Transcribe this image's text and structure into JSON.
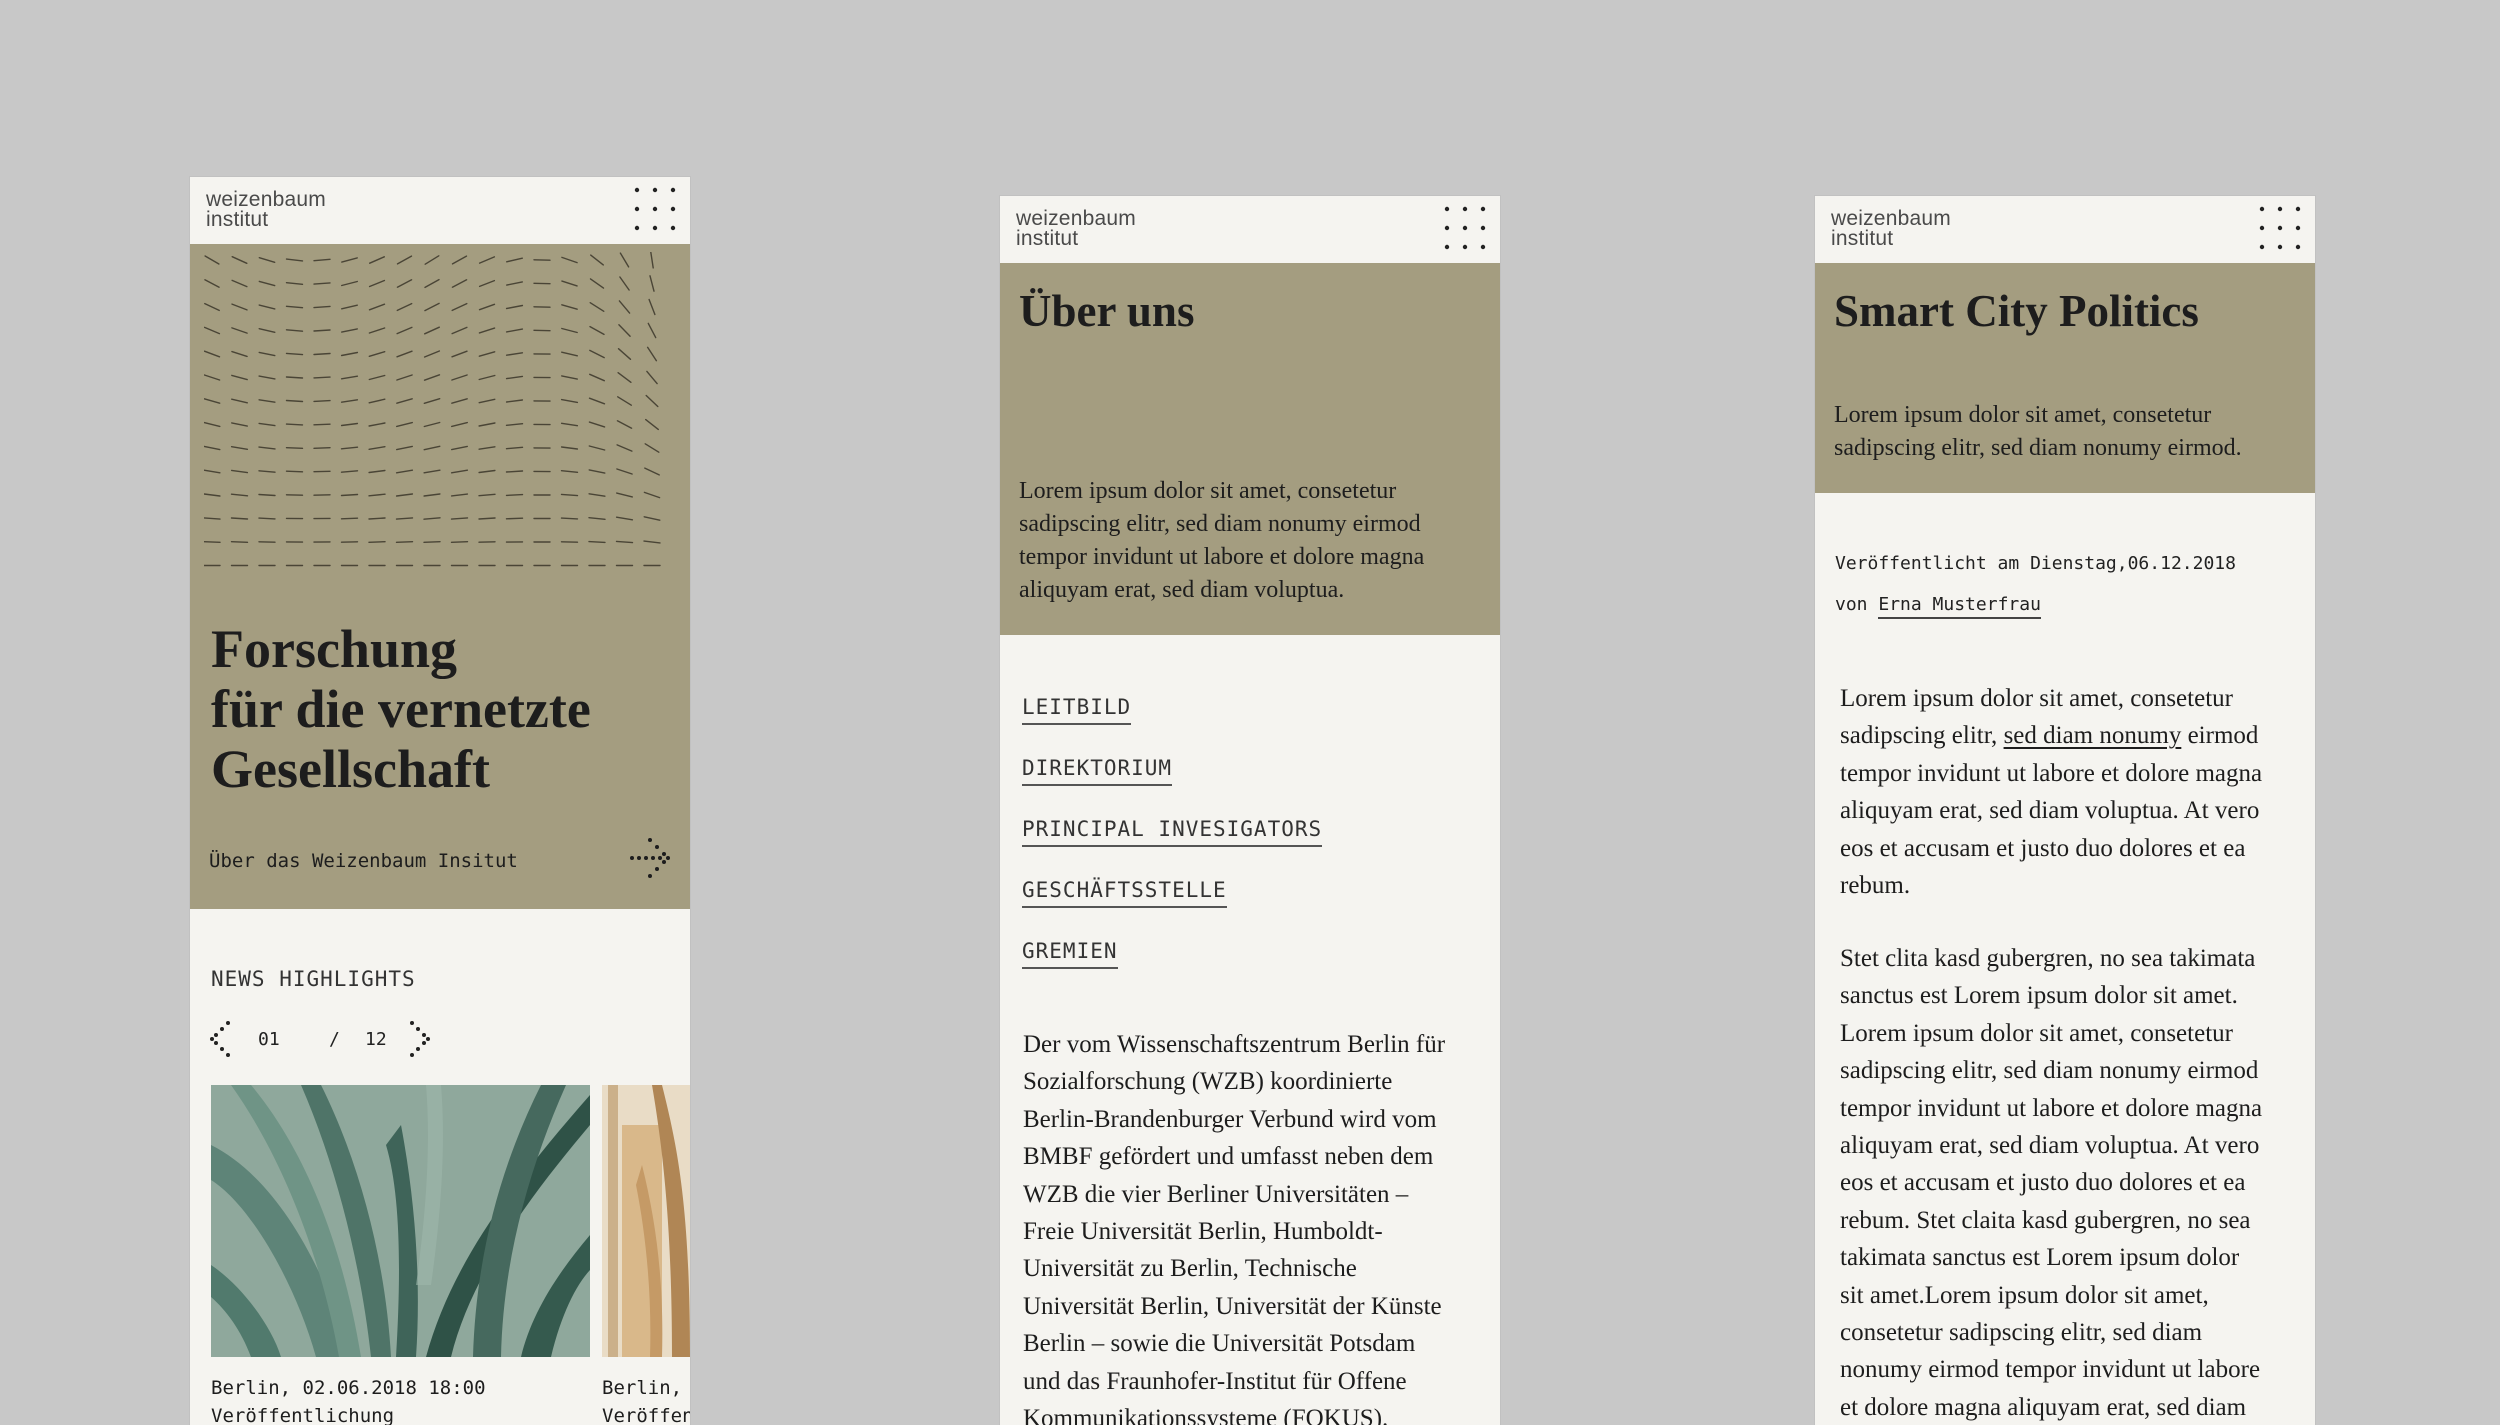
{
  "logo": {
    "line1": "weizenbaum",
    "line2": "institut"
  },
  "colors": {
    "background": "#c8c8c8",
    "page": "#f5f4f0",
    "olive": "#a49d80",
    "text": "#1d1d1d"
  },
  "icons": {
    "menu": "dot-grid-menu-icon",
    "arrow": "dotted-arrow-icon"
  },
  "home": {
    "hero_title": [
      "Forschung",
      "für die vernetzte",
      "Gesellschaft"
    ],
    "hero_link": "Über das Weizenbaum Insitut",
    "news_label": "NEWS HIGHLIGHTS",
    "pager": {
      "current": "01",
      "separator": "/",
      "total": "12"
    },
    "cards": [
      {
        "meta": "Berlin, 02.06.2018 18:00",
        "type": "Veröffentlichung"
      },
      {
        "meta": "Berlin,",
        "type": "Veröffen"
      }
    ]
  },
  "about": {
    "title": "Über uns",
    "intro": [
      "Lorem ipsum dolor sit amet, consetetur",
      "sadipscing elitr, sed diam nonumy eirmod",
      "tempor invidunt ut labore et dolore magna",
      "aliquyam erat, sed diam voluptua."
    ],
    "subnav": [
      "LEITBILD",
      "DIREKTORIUM",
      "PRINCIPAL INVESIGATORS",
      "GESCHÄFTSSTELLE",
      "GREMIEN"
    ],
    "body": [
      "Der vom Wissenschaftszentrum Berlin für",
      "Sozialforschung (WZB) koordinierte",
      "Berlin-Brandenburger Verbund wird vom",
      "BMBF gefördert und umfasst neben dem",
      "WZB die vier Berliner Universitäten –",
      "Freie Universität Berlin, Humboldt-",
      "Universität zu Berlin, Technische",
      "Universität Berlin, Universität der Künste",
      "Berlin – sowie die Universität Potsdam",
      "und das Fraunhofer-Institut für Offene",
      "Kommunikationssysteme (FOKUS)."
    ]
  },
  "article": {
    "title": "Smart City Politics",
    "intro": [
      "Lorem ipsum dolor sit amet, consetetur",
      "sadipscing elitr, sed diam nonumy eirmod."
    ],
    "published": "Veröffentlicht am Dienstag,06.12.2018",
    "by": "von",
    "author": "Erna Musterfrau",
    "p1_line1": "Lorem ipsum dolor sit amet, consetetur",
    "p1_line2_before": "sadipscing elitr, ",
    "p1_link": "sed diam nonumy",
    "p1_line2_after": " eirmod",
    "p1_rest": [
      "tempor invidunt ut labore et dolore magna",
      "aliquyam erat, sed diam voluptua. At vero",
      "eos et accusam et justo duo dolores et ea",
      "rebum."
    ],
    "p2": [
      "Stet clita kasd gubergren, no sea takimata",
      "sanctus est Lorem ipsum dolor sit amet.",
      "Lorem ipsum dolor sit amet, consetetur",
      "sadipscing elitr, sed diam nonumy eirmod",
      "tempor invidunt ut labore et dolore magna",
      "aliquyam erat, sed diam voluptua. At vero",
      "eos et accusam et justo duo dolores et ea",
      "rebum. Stet claita kasd gubergren, no sea",
      "takimata sanctus est Lorem ipsum dolor",
      "sit amet.Lorem ipsum dolor sit amet,",
      "consetetur sadipscing elitr, sed diam",
      "nonumy eirmod tempor invidunt ut labore",
      "et dolore magna aliquyam erat, sed diam"
    ]
  }
}
